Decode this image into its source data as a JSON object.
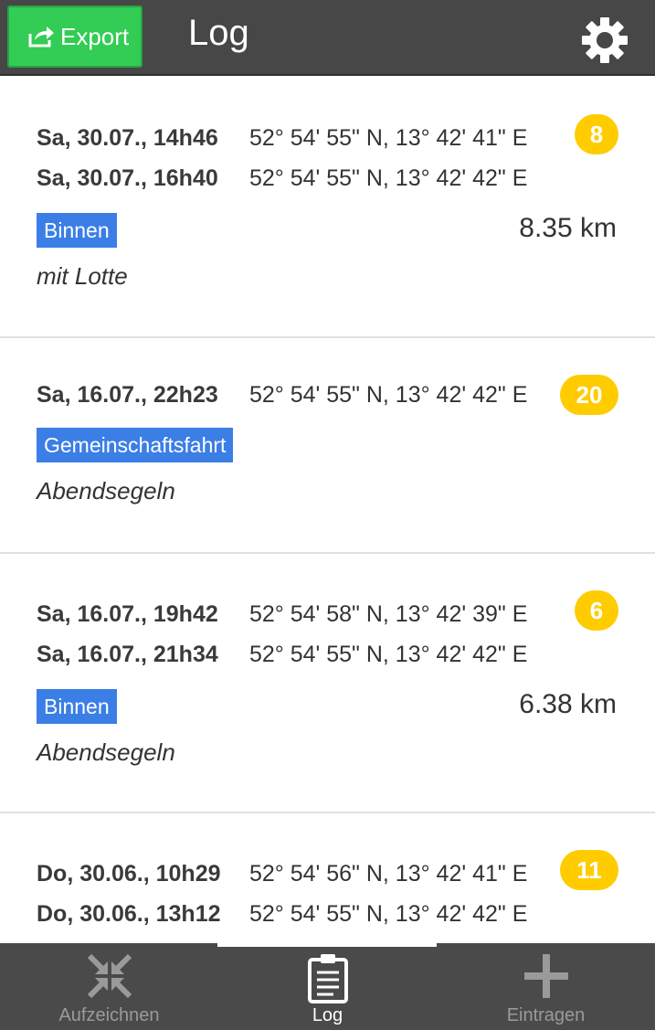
{
  "header": {
    "export_label": "Export",
    "title": "Log",
    "settings_icon": "gear-icon",
    "background": "#474747",
    "export_color": "#33cc55"
  },
  "entries": [
    {
      "rows": [
        {
          "time": "Sa, 30.07., 14h46",
          "coord": "52° 54' 55\" N, 13° 42' 41\" E"
        },
        {
          "time": "Sa, 30.07., 16h40",
          "coord": "52° 54' 55\" N, 13° 42' 42\" E"
        }
      ],
      "badge": "8",
      "tag": "Binnen",
      "distance": "8.35 km",
      "note": "mit Lotte"
    },
    {
      "rows": [
        {
          "time": "Sa, 16.07., 22h23",
          "coord": "52° 54' 55\" N, 13° 42' 42\" E"
        }
      ],
      "badge": "20",
      "tag": "Gemeinschaftsfahrt",
      "distance": "",
      "note": "Abendsegeln"
    },
    {
      "rows": [
        {
          "time": "Sa, 16.07., 19h42",
          "coord": "52° 54' 58\" N, 13° 42' 39\" E"
        },
        {
          "time": "Sa, 16.07., 21h34",
          "coord": "52° 54' 55\" N, 13° 42' 42\" E"
        }
      ],
      "badge": "6",
      "tag": "Binnen",
      "distance": "6.38 km",
      "note": "Abendsegeln"
    },
    {
      "rows": [
        {
          "time": "Do, 30.06., 10h29",
          "coord": "52° 54' 56\" N, 13° 42' 41\" E"
        },
        {
          "time": "Do, 30.06., 13h12",
          "coord": "52° 54' 55\" N, 13° 42' 42\" E"
        }
      ],
      "badge": "11"
    }
  ],
  "nav": {
    "items": [
      {
        "label": "Aufzeichnen",
        "icon": "compress-arrows-icon",
        "active": false
      },
      {
        "label": "Log",
        "icon": "clipboard-icon",
        "active": true
      },
      {
        "label": "Eintragen",
        "icon": "plus-icon",
        "active": false
      }
    ],
    "active_color": "#ffffff",
    "inactive_color": "#9a9a9a"
  },
  "colors": {
    "badge": "#ffcc00",
    "tag": "#3b7ee6"
  }
}
